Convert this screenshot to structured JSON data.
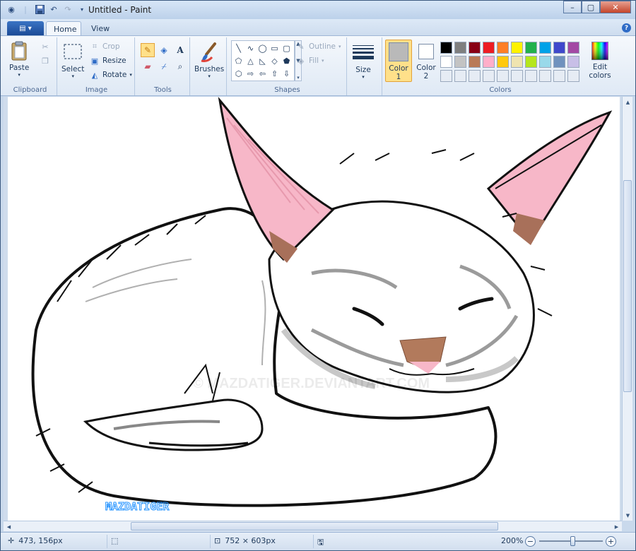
{
  "window": {
    "title": "Untitled - Paint",
    "controls": {
      "minimize": "–",
      "maximize": "▢",
      "close": "✕"
    }
  },
  "tabs": [
    {
      "label": "Home",
      "active": true
    },
    {
      "label": "View",
      "active": false
    }
  ],
  "ribbon": {
    "clipboard": {
      "group_label": "Clipboard",
      "paste_label": "Paste"
    },
    "image": {
      "group_label": "Image",
      "select_label": "Select",
      "crop_label": "Crop",
      "resize_label": "Resize",
      "rotate_label": "Rotate"
    },
    "tools": {
      "group_label": "Tools",
      "active_tool": "pencil-icon"
    },
    "brushes": {
      "label": "Brushes"
    },
    "shapes": {
      "group_label": "Shapes",
      "outline_label": "Outline",
      "fill_label": "Fill"
    },
    "size": {
      "label": "Size"
    },
    "colors": {
      "group_label": "Colors",
      "color1_label_line1": "Color",
      "color1_label_line2": "1",
      "color2_label_line1": "Color",
      "color2_label_line2": "2",
      "edit_label_line1": "Edit",
      "edit_label_line2": "colors",
      "color1_value": "#b9b9b9",
      "color2_value": "#ffffff",
      "palette": [
        "#000000",
        "#7f7f7f",
        "#880015",
        "#ed1c24",
        "#ff7f27",
        "#fff200",
        "#22b14c",
        "#00a2e8",
        "#3f48cc",
        "#a349a4",
        "#ffffff",
        "#c3c3c3",
        "#b97a57",
        "#ffaec9",
        "#ffc90e",
        "#efe4b0",
        "#b5e61d",
        "#99d9ea",
        "#7092be",
        "#c8bfe7",
        "#e6ecf4",
        "#e6ecf4",
        "#e6ecf4",
        "#e6ecf4",
        "#e6ecf4",
        "#e6ecf4",
        "#e6ecf4",
        "#e6ecf4",
        "#e6ecf4",
        "#e6ecf4"
      ]
    }
  },
  "canvas": {
    "signature": "MAZDATIGER",
    "watermark": "© MAZDATIGER.DEVIANTART.COM"
  },
  "status": {
    "cursor_position": "473, 156px",
    "canvas_size": "752 × 603px",
    "zoom": "200%"
  }
}
